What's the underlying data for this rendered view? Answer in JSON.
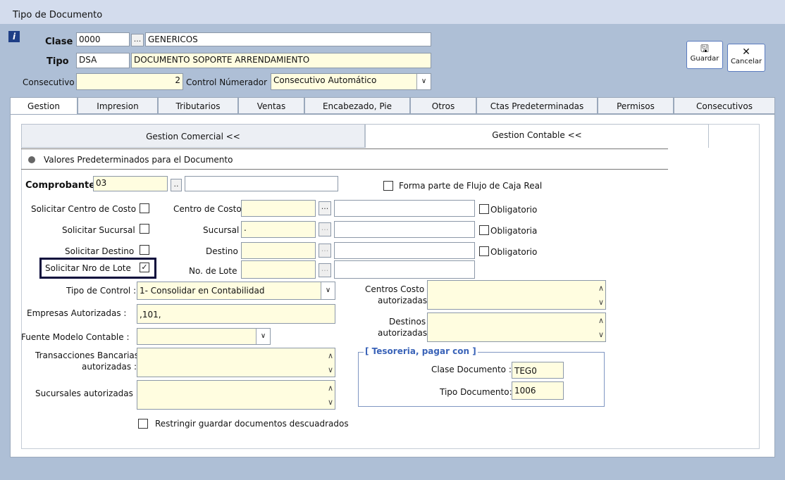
{
  "window": {
    "title": "Tipo de Documento"
  },
  "header": {
    "clase_label": "Clase",
    "clase_code": "0000",
    "clase_name": "GENERICOS",
    "tipo_label": "Tipo",
    "tipo_code": "DSA",
    "tipo_name": "DOCUMENTO SOPORTE ARRENDAMIENTO",
    "consecutivo_label": "Consecutivo",
    "consecutivo_value": "2",
    "control_label": "Control Númerador :",
    "control_value": "Consecutivo Automático",
    "ellipsis": "...",
    "info_icon": "i"
  },
  "toolbar": {
    "guardar_label": "Guardar",
    "cancelar_label": "Cancelar"
  },
  "tabs": [
    "Gestion",
    "Impresion",
    "Tributarios",
    "Ventas",
    "Encabezado, Pie",
    "Otros",
    "Ctas Predeterminadas",
    "Permisos",
    "Consecutivos"
  ],
  "subtabs": {
    "comercial": "Gestion Comercial <<",
    "contable": "Gestion Contable <<"
  },
  "section_title": "Valores Predeterminados para el Documento",
  "comprobante": {
    "label": "Comprobante",
    "value": "03",
    "btn": ".."
  },
  "flujo_caja_label": "Forma parte de Flujo de Caja  Real",
  "rows": {
    "centro_costo": {
      "solicitar_label": "Solicitar Centro de Costo",
      "field_label": "Centro de Costo",
      "value": "",
      "obligatorio_label": "Obligatorio"
    },
    "sucursal": {
      "solicitar_label": "Solicitar Sucursal",
      "field_label": "Sucursal",
      "value": ".",
      "obligatorio_label": "Obligatoria"
    },
    "destino": {
      "solicitar_label": "Solicitar Destino",
      "field_label": "Destino",
      "value": "",
      "obligatorio_label": "Obligatorio"
    },
    "lote": {
      "solicitar_label": "Solicitar Nro de  Lote",
      "field_label": "No. de Lote",
      "value": "",
      "checked_mark": "✓"
    }
  },
  "tipo_control": {
    "label": "Tipo de Control :",
    "value": "1- Consolidar en Contabilidad"
  },
  "empresas": {
    "label": "Empresas Autorizadas :",
    "value": ",101,"
  },
  "fuente_modelo": {
    "label": "Fuente Modelo Contable :",
    "value": ""
  },
  "transacciones": {
    "label_line1": "Transacciones Bancarias",
    "label_line2": "autorizadas :"
  },
  "sucursales_aut": {
    "label": "Sucursales autorizadas :"
  },
  "restringir_label": "Restringir guardar documentos descuadrados",
  "centros_costo_aut": {
    "label_line1": "Centros Costo",
    "label_line2": "autorizadas"
  },
  "destinos_aut": {
    "label_line1": "Destinos",
    "label_line2": "autorizadas"
  },
  "tesoreria": {
    "title": "[ Tesoreria, pagar con ]",
    "clase_label": "Clase Documento :",
    "clase_value": "TEG0",
    "tipo_label": "Tipo Documento:",
    "tipo_value": "1006"
  },
  "arrows": {
    "down": "∨",
    "up": "∧"
  }
}
